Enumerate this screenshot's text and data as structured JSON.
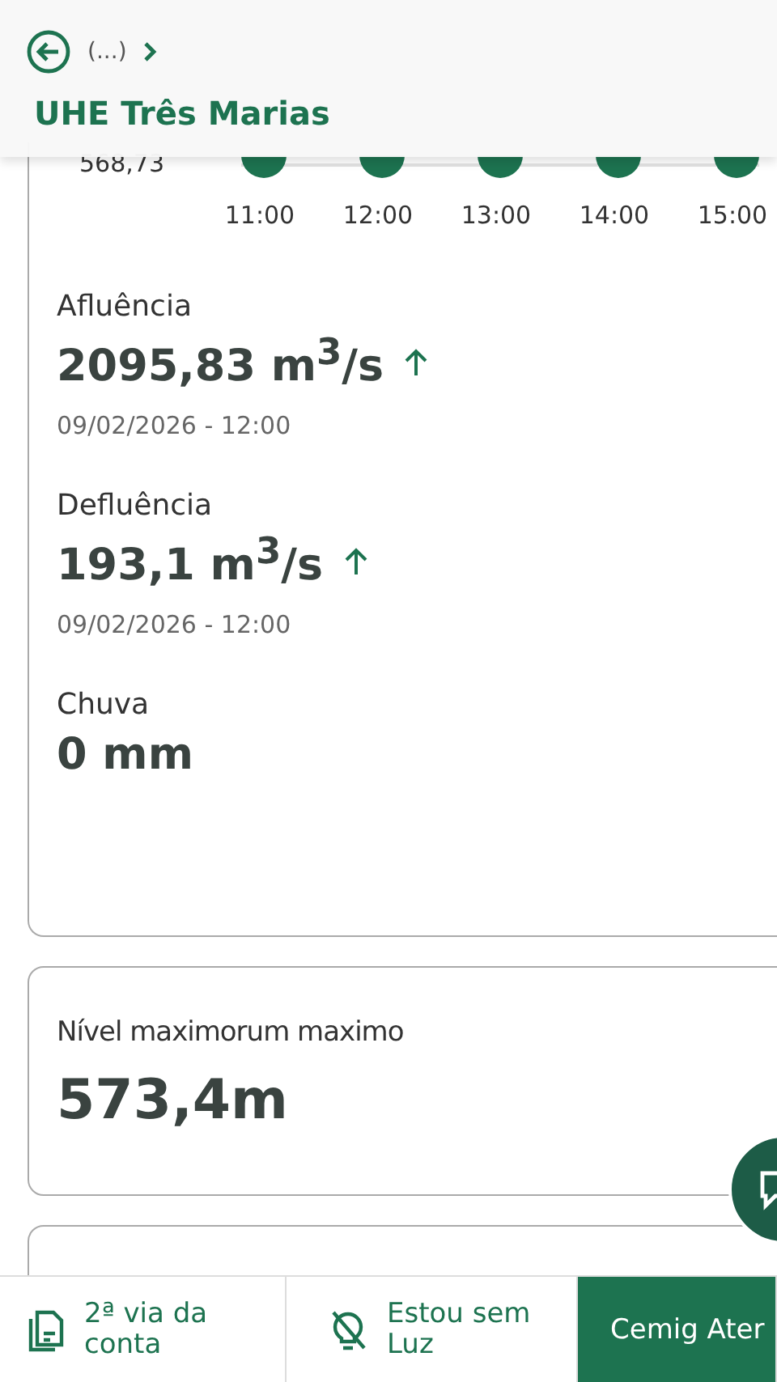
{
  "header": {
    "breadcrumb": "(...)",
    "title": "UHE Três Marias"
  },
  "chart": {
    "y_label": "568,73",
    "x_labels": [
      "11:00",
      "12:00",
      "13:00",
      "14:00",
      "15:00"
    ]
  },
  "metrics": [
    {
      "label": "Afluência",
      "value": "2095,83 m$^{3}$/s",
      "rising": true,
      "date": "09/02/2026 - 12:00"
    },
    {
      "label": "Defluência",
      "value": "193,1 m$^{3}$/s",
      "rising": true,
      "date": "09/02/2026 - 12:00"
    },
    {
      "label": "Chuva",
      "value": "0 mm"
    }
  ],
  "level_card": {
    "label": "Nível maximorum maximo",
    "value": "573,4m"
  },
  "bottom_nav": [
    {
      "kind": "bill",
      "label": "2ª via da conta",
      "selected": false
    },
    {
      "kind": "outage",
      "label": "Estou sem Luz",
      "selected": false
    },
    {
      "kind": "service",
      "label": "Cemig Ater",
      "selected": true
    }
  ]
}
